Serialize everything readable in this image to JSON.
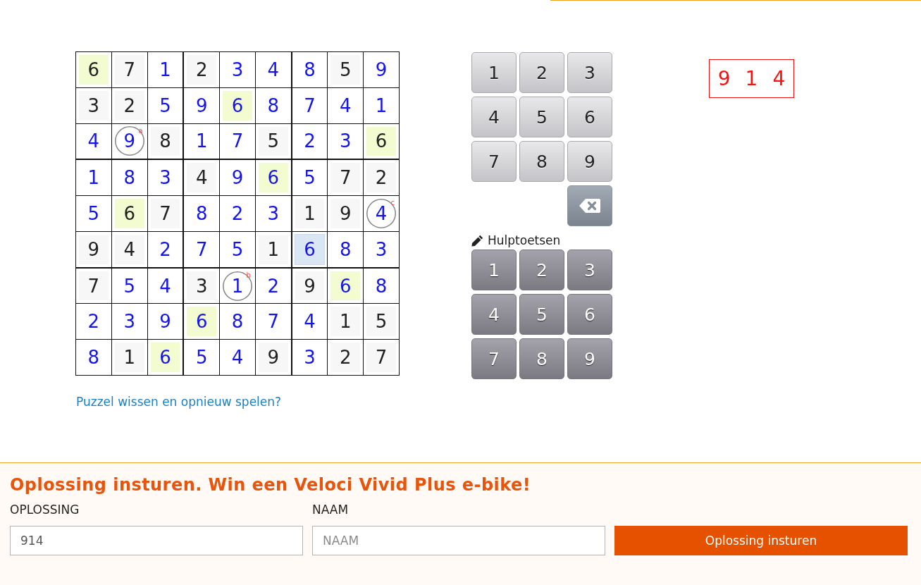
{
  "grid": {
    "rows": [
      [
        {
          "value": "6",
          "kind": "given",
          "highlighted": true,
          "selected": false
        },
        {
          "value": "7",
          "kind": "given",
          "highlighted": false,
          "selected": false
        },
        {
          "value": "1",
          "kind": "entered",
          "highlighted": false,
          "selected": false
        },
        {
          "value": "2",
          "kind": "given",
          "highlighted": false,
          "selected": false
        },
        {
          "value": "3",
          "kind": "entered",
          "highlighted": false,
          "selected": false
        },
        {
          "value": "4",
          "kind": "entered",
          "highlighted": false,
          "selected": false
        },
        {
          "value": "8",
          "kind": "entered",
          "highlighted": false,
          "selected": false
        },
        {
          "value": "5",
          "kind": "given",
          "highlighted": false,
          "selected": false
        },
        {
          "value": "9",
          "kind": "entered",
          "highlighted": false,
          "selected": false
        }
      ],
      [
        {
          "value": "3",
          "kind": "given",
          "highlighted": false,
          "selected": false
        },
        {
          "value": "2",
          "kind": "given",
          "highlighted": false,
          "selected": false
        },
        {
          "value": "5",
          "kind": "entered",
          "highlighted": false,
          "selected": false
        },
        {
          "value": "9",
          "kind": "entered",
          "highlighted": false,
          "selected": false
        },
        {
          "value": "6",
          "kind": "entered",
          "highlighted": true,
          "selected": false
        },
        {
          "value": "8",
          "kind": "entered",
          "highlighted": false,
          "selected": false
        },
        {
          "value": "7",
          "kind": "entered",
          "highlighted": false,
          "selected": false
        },
        {
          "value": "4",
          "kind": "entered",
          "highlighted": false,
          "selected": false
        },
        {
          "value": "1",
          "kind": "entered",
          "highlighted": false,
          "selected": false
        }
      ],
      [
        {
          "value": "4",
          "kind": "entered",
          "highlighted": false,
          "selected": false
        },
        {
          "value": "9",
          "kind": "entered",
          "highlighted": false,
          "selected": false,
          "marker": "a"
        },
        {
          "value": "8",
          "kind": "given",
          "highlighted": false,
          "selected": false
        },
        {
          "value": "1",
          "kind": "entered",
          "highlighted": false,
          "selected": false
        },
        {
          "value": "7",
          "kind": "entered",
          "highlighted": false,
          "selected": false
        },
        {
          "value": "5",
          "kind": "given",
          "highlighted": false,
          "selected": false
        },
        {
          "value": "2",
          "kind": "entered",
          "highlighted": false,
          "selected": false
        },
        {
          "value": "3",
          "kind": "entered",
          "highlighted": false,
          "selected": false
        },
        {
          "value": "6",
          "kind": "given",
          "highlighted": true,
          "selected": false
        }
      ],
      [
        {
          "value": "1",
          "kind": "entered",
          "highlighted": false,
          "selected": false
        },
        {
          "value": "8",
          "kind": "entered",
          "highlighted": false,
          "selected": false
        },
        {
          "value": "3",
          "kind": "entered",
          "highlighted": false,
          "selected": false
        },
        {
          "value": "4",
          "kind": "given",
          "highlighted": false,
          "selected": false
        },
        {
          "value": "9",
          "kind": "entered",
          "highlighted": false,
          "selected": false
        },
        {
          "value": "6",
          "kind": "entered",
          "highlighted": true,
          "selected": false
        },
        {
          "value": "5",
          "kind": "entered",
          "highlighted": false,
          "selected": false
        },
        {
          "value": "7",
          "kind": "given",
          "highlighted": false,
          "selected": false
        },
        {
          "value": "2",
          "kind": "given",
          "highlighted": false,
          "selected": false
        }
      ],
      [
        {
          "value": "5",
          "kind": "entered",
          "highlighted": false,
          "selected": false
        },
        {
          "value": "6",
          "kind": "given",
          "highlighted": true,
          "selected": false
        },
        {
          "value": "7",
          "kind": "given",
          "highlighted": false,
          "selected": false
        },
        {
          "value": "8",
          "kind": "entered",
          "highlighted": false,
          "selected": false
        },
        {
          "value": "2",
          "kind": "entered",
          "highlighted": false,
          "selected": false
        },
        {
          "value": "3",
          "kind": "entered",
          "highlighted": false,
          "selected": false
        },
        {
          "value": "1",
          "kind": "given",
          "highlighted": false,
          "selected": false
        },
        {
          "value": "9",
          "kind": "given",
          "highlighted": false,
          "selected": false
        },
        {
          "value": "4",
          "kind": "entered",
          "highlighted": false,
          "selected": false,
          "marker": "c"
        }
      ],
      [
        {
          "value": "9",
          "kind": "given",
          "highlighted": false,
          "selected": false
        },
        {
          "value": "4",
          "kind": "given",
          "highlighted": false,
          "selected": false
        },
        {
          "value": "2",
          "kind": "entered",
          "highlighted": false,
          "selected": false
        },
        {
          "value": "7",
          "kind": "entered",
          "highlighted": false,
          "selected": false
        },
        {
          "value": "5",
          "kind": "entered",
          "highlighted": false,
          "selected": false
        },
        {
          "value": "1",
          "kind": "given",
          "highlighted": false,
          "selected": false
        },
        {
          "value": "6",
          "kind": "entered",
          "highlighted": false,
          "selected": true
        },
        {
          "value": "8",
          "kind": "entered",
          "highlighted": false,
          "selected": false
        },
        {
          "value": "3",
          "kind": "entered",
          "highlighted": false,
          "selected": false
        }
      ],
      [
        {
          "value": "7",
          "kind": "given",
          "highlighted": false,
          "selected": false
        },
        {
          "value": "5",
          "kind": "entered",
          "highlighted": false,
          "selected": false
        },
        {
          "value": "4",
          "kind": "entered",
          "highlighted": false,
          "selected": false
        },
        {
          "value": "3",
          "kind": "given",
          "highlighted": false,
          "selected": false
        },
        {
          "value": "1",
          "kind": "entered",
          "highlighted": false,
          "selected": false,
          "marker": "b"
        },
        {
          "value": "2",
          "kind": "entered",
          "highlighted": false,
          "selected": false
        },
        {
          "value": "9",
          "kind": "given",
          "highlighted": false,
          "selected": false
        },
        {
          "value": "6",
          "kind": "entered",
          "highlighted": true,
          "selected": false
        },
        {
          "value": "8",
          "kind": "entered",
          "highlighted": false,
          "selected": false
        }
      ],
      [
        {
          "value": "2",
          "kind": "entered",
          "highlighted": false,
          "selected": false
        },
        {
          "value": "3",
          "kind": "entered",
          "highlighted": false,
          "selected": false
        },
        {
          "value": "9",
          "kind": "entered",
          "highlighted": false,
          "selected": false
        },
        {
          "value": "6",
          "kind": "entered",
          "highlighted": true,
          "selected": false
        },
        {
          "value": "8",
          "kind": "entered",
          "highlighted": false,
          "selected": false
        },
        {
          "value": "7",
          "kind": "entered",
          "highlighted": false,
          "selected": false
        },
        {
          "value": "4",
          "kind": "entered",
          "highlighted": false,
          "selected": false
        },
        {
          "value": "1",
          "kind": "given",
          "highlighted": false,
          "selected": false
        },
        {
          "value": "5",
          "kind": "given",
          "highlighted": false,
          "selected": false
        }
      ],
      [
        {
          "value": "8",
          "kind": "entered",
          "highlighted": false,
          "selected": false
        },
        {
          "value": "1",
          "kind": "given",
          "highlighted": false,
          "selected": false
        },
        {
          "value": "6",
          "kind": "entered",
          "highlighted": true,
          "selected": false
        },
        {
          "value": "5",
          "kind": "entered",
          "highlighted": false,
          "selected": false
        },
        {
          "value": "4",
          "kind": "entered",
          "highlighted": false,
          "selected": false
        },
        {
          "value": "9",
          "kind": "given",
          "highlighted": false,
          "selected": false
        },
        {
          "value": "3",
          "kind": "entered",
          "highlighted": false,
          "selected": false
        },
        {
          "value": "2",
          "kind": "given",
          "highlighted": false,
          "selected": false
        },
        {
          "value": "7",
          "kind": "given",
          "highlighted": false,
          "selected": false
        }
      ]
    ]
  },
  "reset_link": "Puzzel wissen en opnieuw spelen?",
  "keypad": {
    "number_keys": [
      "1",
      "2",
      "3",
      "4",
      "5",
      "6",
      "7",
      "8",
      "9"
    ],
    "hint_label": "Hulptoetsen",
    "hint_keys": [
      "1",
      "2",
      "3",
      "4",
      "5",
      "6",
      "7",
      "8",
      "9"
    ]
  },
  "answer": {
    "digits": [
      "9",
      "1",
      "4"
    ]
  },
  "submit_form": {
    "title": "Oplossing insturen. Win een Veloci Vivid Plus e-bike!",
    "fields": [
      {
        "label": "OPLOSSING",
        "value": "914"
      },
      {
        "label": "NAAM",
        "placeholder": "NAAM"
      }
    ],
    "button": "Oplossing insturen"
  }
}
